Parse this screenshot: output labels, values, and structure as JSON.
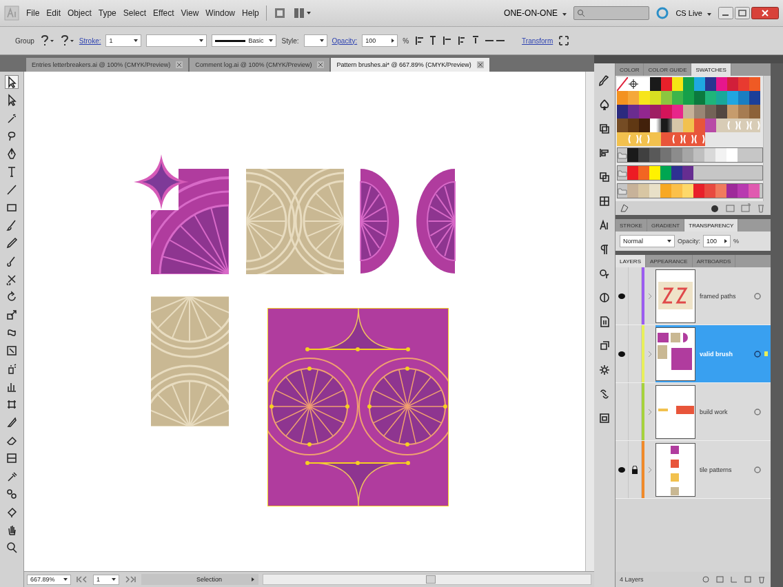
{
  "app_bar": {
    "menus": [
      "File",
      "Edit",
      "Object",
      "Type",
      "Select",
      "Effect",
      "View",
      "Window",
      "Help"
    ],
    "workspace": "ONE-ON-ONE",
    "cs_live": "CS Live"
  },
  "control_bar": {
    "selection": "Group",
    "stroke_label": "Stroke:",
    "stroke_value": "1",
    "brush": "Basic",
    "style_label": "Style:",
    "opacity_label": "Opacity:",
    "opacity_value": "100",
    "percent": "%",
    "transform": "Transform"
  },
  "document_tabs": [
    {
      "label": "Entries letterbreakers.ai @ 100% (CMYK/Preview)",
      "selected": false
    },
    {
      "label": "Comment log.ai @ 100% (CMYK/Preview)",
      "selected": false
    },
    {
      "label": "Pattern brushes.ai* @ 667.89% (CMYK/Preview)",
      "selected": true
    }
  ],
  "status_bar": {
    "zoom": "667.89%",
    "artboard": "1",
    "status": "Selection"
  },
  "swatches_panel": {
    "tabs": [
      {
        "label": "COLOR",
        "selected": false
      },
      {
        "label": "COLOR GUIDE",
        "selected": false
      },
      {
        "label": "SWATCHES",
        "selected": true
      }
    ],
    "rows": [
      {
        "kind": "plain",
        "swatches": [
          {
            "kind": "none"
          },
          {
            "kind": "registration"
          },
          {
            "kind": "solid",
            "color": "#ffffff"
          },
          {
            "kind": "solid",
            "color": "#1a1a1a"
          },
          {
            "kind": "solid",
            "color": "#e8202a"
          },
          {
            "kind": "solid",
            "color": "#f5e614"
          },
          {
            "kind": "solid",
            "color": "#12a04a"
          },
          {
            "kind": "solid",
            "color": "#1fa8e0"
          },
          {
            "kind": "solid",
            "color": "#2a3590"
          },
          {
            "kind": "solid",
            "color": "#e6168c"
          },
          {
            "kind": "solid",
            "color": "#d11f3a"
          },
          {
            "kind": "solid",
            "color": "#e83a30"
          },
          {
            "kind": "solid",
            "color": "#ef5a24"
          }
        ]
      },
      {
        "kind": "plain",
        "swatches": [
          {
            "kind": "solid",
            "color": "#f39220"
          },
          {
            "kind": "solid",
            "color": "#f5a83a"
          },
          {
            "kind": "solid",
            "color": "#f7e51c"
          },
          {
            "kind": "solid",
            "color": "#d8e021"
          },
          {
            "kind": "solid",
            "color": "#8cc63f"
          },
          {
            "kind": "solid",
            "color": "#3db54a"
          },
          {
            "kind": "solid",
            "color": "#16a04a"
          },
          {
            "kind": "solid",
            "color": "#0b7a3e"
          },
          {
            "kind": "solid",
            "color": "#1fb57a"
          },
          {
            "kind": "solid",
            "color": "#19a89a"
          },
          {
            "kind": "solid",
            "color": "#21a6e0"
          },
          {
            "kind": "solid",
            "color": "#1a7ec2"
          },
          {
            "kind": "solid",
            "color": "#1b3f99"
          }
        ]
      },
      {
        "kind": "plain",
        "swatches": [
          {
            "kind": "solid",
            "color": "#2b2a7e"
          },
          {
            "kind": "solid",
            "color": "#6a2c8f"
          },
          {
            "kind": "solid",
            "color": "#92278f"
          },
          {
            "kind": "solid",
            "color": "#9e1f63"
          },
          {
            "kind": "solid",
            "color": "#d4145a"
          },
          {
            "kind": "solid",
            "color": "#e8258a"
          },
          {
            "kind": "solid",
            "color": "#c7b299"
          },
          {
            "kind": "solid",
            "color": "#998675"
          },
          {
            "kind": "solid",
            "color": "#736357"
          },
          {
            "kind": "solid",
            "color": "#534741"
          },
          {
            "kind": "solid",
            "color": "#c69c6d"
          },
          {
            "kind": "solid",
            "color": "#a67c52"
          },
          {
            "kind": "solid",
            "color": "#8c6239"
          }
        ]
      },
      {
        "kind": "plain",
        "swatches": [
          {
            "kind": "solid",
            "color": "#754c24"
          },
          {
            "kind": "solid",
            "color": "#603813"
          },
          {
            "kind": "solid",
            "color": "#42210b"
          },
          {
            "kind": "gradient",
            "color": "#ffffff"
          },
          {
            "kind": "gradient",
            "color": "#1a1a1a"
          },
          {
            "kind": "solid",
            "color": "#d7c6a8"
          },
          {
            "kind": "solid",
            "color": "#f2c14e"
          },
          {
            "kind": "solid",
            "color": "#e8553a"
          },
          {
            "kind": "solid",
            "color": "#b84aa6"
          },
          {
            "kind": "solid",
            "color": "#d8ccb6"
          },
          {
            "kind": "pattern",
            "color": "#d8ccb6"
          },
          {
            "kind": "pattern",
            "color": "#d8ccb6"
          },
          {
            "kind": "pattern",
            "color": "#d8ccb6"
          }
        ]
      },
      {
        "kind": "plain",
        "swatches": [
          {
            "kind": "solid",
            "color": "#f2c14e"
          },
          {
            "kind": "pattern",
            "color": "#f2c14e"
          },
          {
            "kind": "pattern",
            "color": "#f2c14e"
          },
          {
            "kind": "solid",
            "color": "#f2c14e"
          },
          {
            "kind": "solid",
            "color": "#e8553a"
          },
          {
            "kind": "pattern",
            "color": "#e8553a"
          },
          {
            "kind": "pattern",
            "color": "#e8553a"
          },
          {
            "kind": "pattern",
            "color": "#e8553a"
          }
        ]
      },
      {
        "kind": "group",
        "swatches": [
          {
            "kind": "solid",
            "color": "#1a1a1a"
          },
          {
            "kind": "solid",
            "color": "#404040"
          },
          {
            "kind": "solid",
            "color": "#595959"
          },
          {
            "kind": "solid",
            "color": "#737373"
          },
          {
            "kind": "solid",
            "color": "#8c8c8c"
          },
          {
            "kind": "solid",
            "color": "#a6a6a6"
          },
          {
            "kind": "solid",
            "color": "#bfbfbf"
          },
          {
            "kind": "solid",
            "color": "#d9d9d9"
          },
          {
            "kind": "solid",
            "color": "#f2f2f2"
          },
          {
            "kind": "solid",
            "color": "#ffffff"
          }
        ]
      },
      {
        "kind": "group",
        "swatches": [
          {
            "kind": "solid",
            "color": "#ed1c24"
          },
          {
            "kind": "solid",
            "color": "#f26522"
          },
          {
            "kind": "solid",
            "color": "#fff200"
          },
          {
            "kind": "solid",
            "color": "#00a651"
          },
          {
            "kind": "solid",
            "color": "#2e3192"
          },
          {
            "kind": "solid",
            "color": "#662d91"
          }
        ]
      },
      {
        "kind": "group",
        "swatches": [
          {
            "kind": "solid",
            "color": "#c7b299"
          },
          {
            "kind": "solid",
            "color": "#d8c6a3"
          },
          {
            "kind": "solid",
            "color": "#e8e0c8"
          },
          {
            "kind": "solid",
            "color": "#f7a823"
          },
          {
            "kind": "solid",
            "color": "#fbc04a"
          },
          {
            "kind": "solid",
            "color": "#fdd86a"
          },
          {
            "kind": "solid",
            "color": "#e8202a"
          },
          {
            "kind": "solid",
            "color": "#e84a40"
          },
          {
            "kind": "solid",
            "color": "#f07b5e"
          },
          {
            "kind": "solid",
            "color": "#9e2a9a"
          },
          {
            "kind": "solid",
            "color": "#b83ab0"
          },
          {
            "kind": "solid",
            "color": "#e05ab0"
          }
        ]
      }
    ]
  },
  "transparency_panel": {
    "tabs": [
      {
        "label": "STROKE",
        "selected": false
      },
      {
        "label": "GRADIENT",
        "selected": false
      },
      {
        "label": "TRANSPARENCY",
        "selected": true
      }
    ],
    "blend_mode": "Normal",
    "opacity_label": "Opacity:",
    "opacity_value": "100",
    "percent": "%"
  },
  "layers_panel": {
    "tabs": [
      {
        "label": "LAYERS",
        "selected": true
      },
      {
        "label": "APPEARANCE",
        "selected": false
      },
      {
        "label": "ARTBOARDS",
        "selected": false
      }
    ],
    "layers": [
      {
        "name": "framed paths",
        "color": "#9b5cf0",
        "visible": true,
        "locked": false,
        "selected": false
      },
      {
        "name": "valid brush",
        "color": "#e8ef5a",
        "visible": true,
        "locked": false,
        "selected": true
      },
      {
        "name": "build work",
        "color": "#a6d23c",
        "visible": false,
        "locked": false,
        "selected": false
      },
      {
        "name": "tile patterns",
        "color": "#f08a2a",
        "visible": true,
        "locked": true,
        "selected": false
      }
    ],
    "count": "4 Layers"
  }
}
